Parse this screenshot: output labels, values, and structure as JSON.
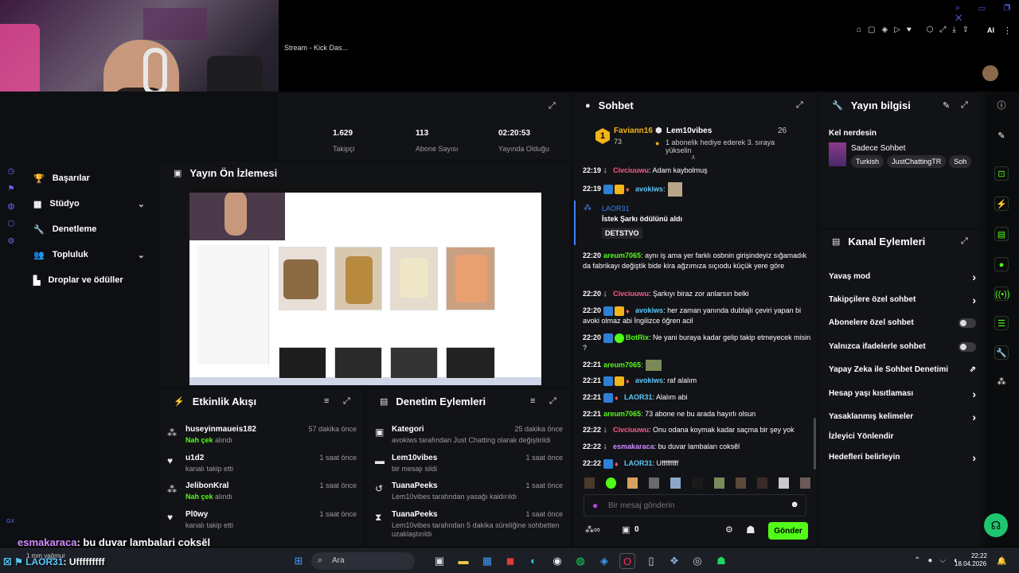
{
  "window": {
    "tab_title": "Stream - Kick Das...",
    "ai_label": "AI"
  },
  "stats": [
    {
      "value": "1.629",
      "label": "Takipçi"
    },
    {
      "value": "113",
      "label": "Abone Sayısı"
    },
    {
      "value": "02:20:53",
      "label": "Yayında Olduğu"
    }
  ],
  "sidebar": {
    "items": [
      {
        "label": "Başarılar"
      },
      {
        "label": "Stüdyo"
      },
      {
        "label": "Denetleme"
      },
      {
        "label": "Topluluk"
      },
      {
        "label": "Droplar ve ödüller"
      }
    ]
  },
  "preview": {
    "title": "Yayın Ön İzlemesi"
  },
  "activity": {
    "title": "Etkinlik Akışı",
    "items": [
      {
        "name": "huseyinmaueis182",
        "sub_highlight": "Nah çek",
        "sub": " alındı",
        "time": "57 dakika önce"
      },
      {
        "name": "u1d2",
        "sub_highlight": "",
        "sub": "kanalı takip etti",
        "time": "1 saat önce"
      },
      {
        "name": "JelibonKral",
        "sub_highlight": "Nah çek",
        "sub": " alındı",
        "time": "1 saat önce"
      },
      {
        "name": "Pl0wy",
        "sub_highlight": "",
        "sub": "kanalı takip etti",
        "time": "1 saat önce"
      }
    ]
  },
  "moderation": {
    "title": "Denetim Eylemleri",
    "items": [
      {
        "name": "Kategori",
        "line": "avokiws tarafından Just Chatting olarak değiştirildi",
        "time": "25 dakika önce"
      },
      {
        "name": "Lem10vibes",
        "line": "bir mesajı sildi",
        "time": "1 saat önce"
      },
      {
        "name": "TuanaPeeks",
        "line": "Lem10vibes tarafından yasağı kaldırıldı",
        "time": "1 saat önce"
      },
      {
        "name": "TuanaPeeks",
        "line": "Lem10vibes tarafından 5 dakika süreliğine sohbetten uzaklaştırıldı",
        "time": "1 saat önce"
      }
    ]
  },
  "chat": {
    "title": "Sohbet",
    "pinned": {
      "user1": "Faviann16",
      "count1": "73",
      "user2": "Lem10vibes",
      "count2": "26",
      "text": "1 abonelik hediye ederek 3. sıraya yükselin"
    },
    "reward": {
      "user": "LAOR31",
      "text": "İstek Şarkı ödülünü aldı",
      "code": "DETSTVO"
    },
    "messages": [
      {
        "time": "22:19",
        "user": "Civciuuwu",
        "color": "#ff5a8a",
        "text": ": Adam kaybolmuş"
      },
      {
        "time": "22:19",
        "user": "avokiws",
        "color": "#5ac8fa",
        "text": ":"
      },
      {
        "time": "22:20",
        "user": "areum7065",
        "color": "#53fc18",
        "text": ": aynı iş ama yer farklı osbnin girişindeyiz sığamadık da fabrikayı değiştik bide kira ağzımıza sıçıodu küçük yere göre"
      },
      {
        "time": "22:20",
        "user": "Civciuuwu",
        "color": "#ff5a8a",
        "text": ": Şarkıyı biraz zor anlarsın belki"
      },
      {
        "time": "22:20",
        "user": "avokiws",
        "color": "#5ac8fa",
        "text": ": her zaman yanında dublajlı çeviri yapan bi avoki olmaz abi İngilizce öğren acil"
      },
      {
        "time": "22:20",
        "user": "BotRix",
        "color": "#53fc18",
        "text": ": Ne yani buraya kadar gelip takip etmeyecek misin ?"
      },
      {
        "time": "22:21",
        "user": "areum7065",
        "color": "#53fc18",
        "text": ":"
      },
      {
        "time": "22:21",
        "user": "avokiws",
        "color": "#5ac8fa",
        "text": ": raf alalım"
      },
      {
        "time": "22:21",
        "user": "LAOR31",
        "color": "#5ac8fa",
        "text": ": Alalım abi"
      },
      {
        "time": "22:21",
        "user": "areum7065",
        "color": "#53fc18",
        "text": ": 73 abone ne bu arada hayırlı olsun"
      },
      {
        "time": "22:22",
        "user": "Civciuuwu",
        "color": "#ff5a8a",
        "text": ": Onu odana koymak kadar saçma bir şey yok"
      },
      {
        "time": "22:22",
        "user": "esmakaraca",
        "color": "#d18bff",
        "text": ": bu duvar lambaları coksĕl"
      },
      {
        "time": "22:22",
        "user": "LAOR31",
        "color": "#5ac8fa",
        "text": ": Ufffffffff"
      }
    ],
    "input_placeholder": "Bir mesaj gönderin",
    "points": "0",
    "send_label": "Gönder"
  },
  "stream_info": {
    "title": "Yayın bilgisi",
    "where": "Kel nerdesin",
    "category": "Sadece Sohbet",
    "tags": [
      "Turkish",
      "JustChattingTR",
      "Soh"
    ]
  },
  "channel_actions": {
    "title": "Kanal Eylemleri",
    "items": [
      {
        "label": "Yavaş mod",
        "kind": "arrow"
      },
      {
        "label": "Takipçilere özel sohbet",
        "kind": "arrow"
      },
      {
        "label": "Abonelere özel sohbet",
        "kind": "toggle"
      },
      {
        "label": "Yalnızca ifadelerle sohbet",
        "kind": "toggle"
      },
      {
        "label": "Yapay Zeka ile Sohbet Denetimi",
        "kind": "ext"
      },
      {
        "label": "Hesap yaşı kısıtlaması",
        "kind": "arrow"
      },
      {
        "label": "Yasaklanmış kelimeler",
        "kind": "arrow"
      },
      {
        "label": "İzleyici Yönlendir",
        "kind": "none"
      },
      {
        "label": "Hedefleri belirleyin",
        "kind": "arrow"
      }
    ]
  },
  "overlay": {
    "line1_user": "esmakaraca",
    "line1_text": ": bu duvar lambalari coksĕl",
    "line2_user": "LAOR31",
    "line2_text": ": Ufffffffff",
    "weather": "1 mm yağmur"
  },
  "taskbar": {
    "search": "Ara",
    "time": "22:22",
    "date": "18.04.2026"
  },
  "colors": {
    "accent": "#53fc18",
    "bg": "#0e0f12"
  }
}
